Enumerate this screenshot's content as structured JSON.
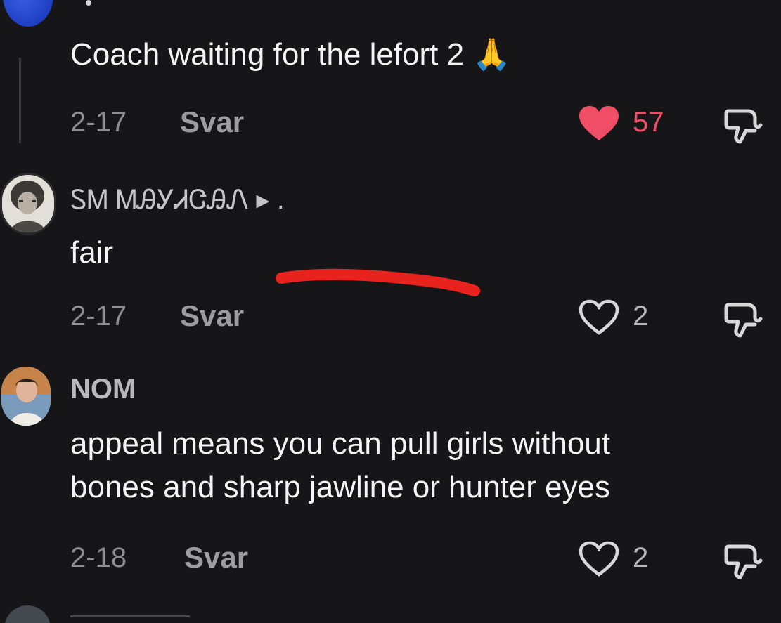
{
  "comments": [
    {
      "text": "Coach waiting for the lefort 2 🙏",
      "date": "2-17",
      "reply_label": "Svar",
      "likes": "57",
      "liked": true
    },
    {
      "username": "ᏚᎷ ᎷᎯᎩᏗᏣᎯᏁ ▸ .",
      "text": "fair",
      "date": "2-17",
      "reply_label": "Svar",
      "likes": "2",
      "liked": false
    },
    {
      "username": "NOM",
      "text_line1": "appeal means you can pull girls without",
      "text_line2": "bones and sharp jawline or hunter eyes",
      "date": "2-18",
      "reply_label": "Svar",
      "likes": "2",
      "liked": false
    }
  ],
  "colors": {
    "background": "#161618",
    "liked_heart": "#f04d66",
    "annotation_stroke": "#e8231e"
  },
  "icons": [
    "heart-filled-icon",
    "heart-outline-icon",
    "dislike-icon"
  ]
}
